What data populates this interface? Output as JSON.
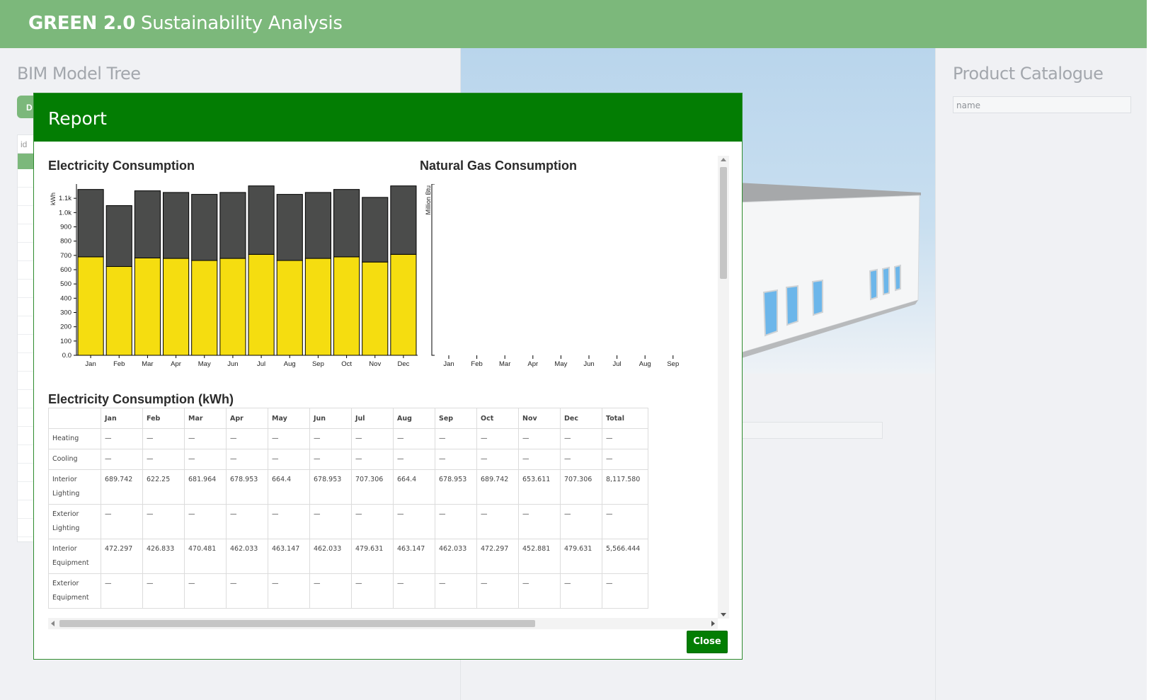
{
  "app": {
    "brand_bold": "GREEN 2.0",
    "brand_rest": " Sustainability Analysis"
  },
  "left_panel": {
    "title": "BIM Model Tree",
    "button_label": "D",
    "table_header": "id"
  },
  "right_panel": {
    "title": "Product Catalogue",
    "search_placeholder": "name"
  },
  "modal": {
    "title": "Report",
    "close_label": "Close",
    "electricity_title": "Electricity Consumption",
    "gas_title": "Natural Gas Consumption",
    "table_title": "Electricity Consumption (kWh)"
  },
  "chart_data": [
    {
      "type": "bar",
      "stacked": true,
      "title": "Electricity Consumption",
      "ylabel": "kWh",
      "ylim": [
        0,
        1200
      ],
      "yticks": [
        "0.0",
        "100",
        "200",
        "300",
        "400",
        "500",
        "600",
        "700",
        "800",
        "900",
        "1.0k",
        "1.1k"
      ],
      "categories": [
        "Jan",
        "Feb",
        "Mar",
        "Apr",
        "May",
        "Jun",
        "Jul",
        "Aug",
        "Sep",
        "Oct",
        "Nov",
        "Dec"
      ],
      "series": [
        {
          "values": [
            689.742,
            622.25,
            681.964,
            678.953,
            664.4,
            678.953,
            707.306,
            664.4,
            678.953,
            689.742,
            653.611,
            707.306
          ],
          "color": "#f5dd10"
        },
        {
          "values": [
            472.297,
            426.833,
            470.481,
            462.033,
            463.147,
            462.033,
            479.631,
            463.147,
            462.033,
            472.297,
            452.881,
            479.631
          ],
          "color": "#4b4c4b"
        }
      ],
      "grid": false
    },
    {
      "type": "bar",
      "title": "Natural Gas Consumption",
      "ylabel": "Million Btu",
      "categories": [
        "Jan",
        "Feb",
        "Mar",
        "Apr",
        "May",
        "Jun",
        "Jul",
        "Aug",
        "Sep"
      ],
      "series": [],
      "grid": false
    }
  ],
  "table": {
    "headers": [
      "",
      "Jan",
      "Feb",
      "Mar",
      "Apr",
      "May",
      "Jun",
      "Jul",
      "Aug",
      "Sep",
      "Oct",
      "Nov",
      "Dec",
      "Total"
    ],
    "rows": [
      {
        "label": [
          "Heating"
        ],
        "cells": [
          "—",
          "—",
          "—",
          "—",
          "—",
          "—",
          "—",
          "—",
          "—",
          "—",
          "—",
          "—",
          "—"
        ]
      },
      {
        "label": [
          "Cooling"
        ],
        "cells": [
          "—",
          "—",
          "—",
          "—",
          "—",
          "—",
          "—",
          "—",
          "—",
          "—",
          "—",
          "—",
          "—"
        ]
      },
      {
        "label": [
          "Interior",
          "Lighting"
        ],
        "cells": [
          "689.742",
          "622.25",
          "681.964",
          "678.953",
          "664.4",
          "678.953",
          "707.306",
          "664.4",
          "678.953",
          "689.742",
          "653.611",
          "707.306",
          "8,117.580"
        ]
      },
      {
        "label": [
          "Exterior",
          "Lighting"
        ],
        "cells": [
          "—",
          "—",
          "—",
          "—",
          "—",
          "—",
          "—",
          "—",
          "—",
          "—",
          "—",
          "—",
          "—"
        ]
      },
      {
        "label": [
          "Interior",
          "Equipment"
        ],
        "cells": [
          "472.297",
          "426.833",
          "470.481",
          "462.033",
          "463.147",
          "462.033",
          "479.631",
          "463.147",
          "462.033",
          "472.297",
          "452.881",
          "479.631",
          "5,566.444"
        ]
      },
      {
        "label": [
          "Exterior",
          "Equipment"
        ],
        "cells": [
          "—",
          "—",
          "—",
          "—",
          "—",
          "—",
          "—",
          "—",
          "—",
          "—",
          "—",
          "—",
          "—"
        ]
      }
    ]
  }
}
